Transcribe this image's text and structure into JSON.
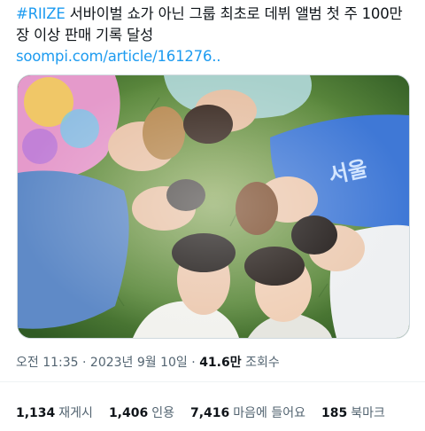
{
  "tweet": {
    "hashtag": "#RIIZE",
    "text": " 서바이벌 쇼가 아닌 그룹 최초로 데뷔 앨범 첫 주 100만 장 이상 판매 기록 달성",
    "link": "soompi.com/article/161276.."
  },
  "photo": {
    "shirt_text": "서울"
  },
  "meta": {
    "time": "오전 11:35",
    "separator1": " · ",
    "date": "2023년 9월 10일",
    "separator2": " · ",
    "views": "41.6만",
    "views_label": " 조회수"
  },
  "stats": [
    {
      "count": "1,134",
      "label": "재게시"
    },
    {
      "count": "1,406",
      "label": "인용"
    },
    {
      "count": "7,416",
      "label": "마음에 들어요"
    },
    {
      "count": "185",
      "label": "북마크"
    }
  ],
  "colors": {
    "link": "#1d9bf0",
    "text": "#0f1419",
    "muted": "#536471"
  }
}
